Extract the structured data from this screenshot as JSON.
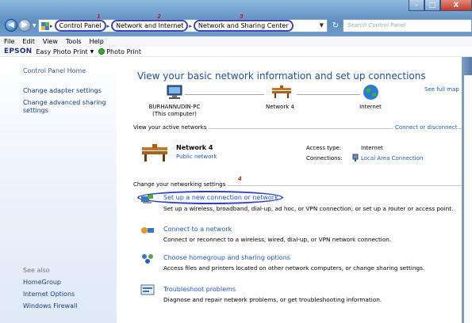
{
  "window": {
    "min_glyph": "–",
    "max_glyph": "□",
    "close_glyph": "X"
  },
  "address": {
    "crumbs": [
      "Control Panel",
      "Network and Internet",
      "Network and Sharing Center"
    ],
    "search_placeholder": "Search Control Panel",
    "annotations": [
      "1",
      "2",
      "3",
      "4"
    ]
  },
  "menu": [
    "File",
    "Edit",
    "View",
    "Tools",
    "Help"
  ],
  "epson": {
    "logo": "EPSON",
    "item1": "Easy Photo Print",
    "item2": "Photo Print"
  },
  "sidebar": {
    "home": "Control Panel Home",
    "links": [
      "Change adapter settings",
      "Change advanced sharing settings"
    ],
    "see_also_label": "See also",
    "see_also": [
      "HomeGroup",
      "Internet Options",
      "Windows Firewall"
    ]
  },
  "main": {
    "heading": "View your basic network information and set up connections",
    "see_full_map": "See full map",
    "nodes": [
      {
        "label": "BURHANNUDIN-PC",
        "sub": "(This computer)"
      },
      {
        "label": "Network 4",
        "sub": ""
      },
      {
        "label": "Internet",
        "sub": ""
      }
    ],
    "active_label": "View your active networks",
    "connect_or_disconnect": "Connect or disconnect",
    "network": {
      "name": "Network 4",
      "type": "Public network",
      "access_type_label": "Access type:",
      "access_type_value": "Internet",
      "connections_label": "Connections:",
      "connections_value": "Local Area Connection"
    },
    "change_label": "Change your networking settings",
    "tasks": [
      {
        "title": "Set up a new connection or network",
        "desc": "Set up a wireless, broadband, dial-up, ad hoc, or VPN connection; or set up a router or access point."
      },
      {
        "title": "Connect to a network",
        "desc": "Connect or reconnect to a wireless, wired, dial-up, or VPN network connection."
      },
      {
        "title": "Choose homegroup and sharing options",
        "desc": "Access files and printers located on other network computers, or change sharing settings."
      },
      {
        "title": "Troubleshoot problems",
        "desc": "Diagnose and repair network problems, or get troubleshooting information."
      }
    ]
  },
  "colors": {
    "link": "#1c56c0",
    "heading": "#1e4f9c",
    "annotation_red": "#d41414",
    "annotation_blue": "#2b3ec8"
  }
}
